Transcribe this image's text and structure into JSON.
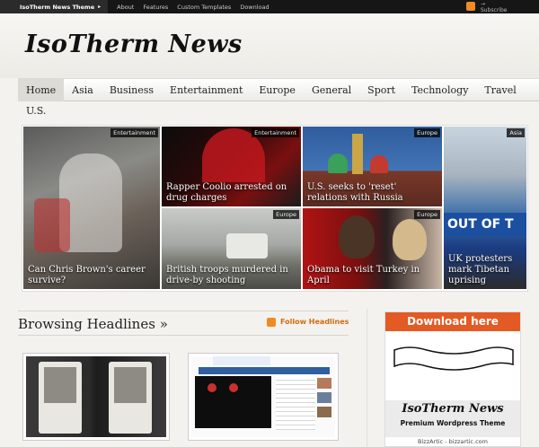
{
  "topbar": {
    "brand": "IsoTherm News Theme",
    "links": [
      "About",
      "Features",
      "Custom Templates",
      "Download"
    ],
    "subscribe": "Subscribe"
  },
  "header": {
    "logo": "IsoTherm News"
  },
  "nav": {
    "items": [
      "Home",
      "Asia",
      "Business",
      "Entertainment",
      "Europe",
      "General",
      "Sport",
      "Technology",
      "Travel"
    ],
    "second_row": "U.S.",
    "active": "Home"
  },
  "features": [
    {
      "tag": "Entertainment",
      "caption": "Can Chris Brown's career survive?"
    },
    {
      "tag": "Entertainment",
      "caption": "Rapper Coolio arrested on drug charges"
    },
    {
      "tag": "Europe",
      "caption": "U.S. seeks to 'reset' relations with Russia"
    },
    {
      "tag": "Asia",
      "caption": "UK protesters mark Tibetan uprising"
    },
    {
      "tag": "Europe",
      "caption": "British troops murdered in drive-by shooting"
    },
    {
      "tag": "Europe",
      "caption": "Obama to visit Turkey in April"
    }
  ],
  "browsing": {
    "title": "Browsing Headlines »",
    "follow": "Follow Headlines"
  },
  "ad": {
    "download": "Download here",
    "logo": "IsoTherm News",
    "subtitle": "Premium Wordpress Theme",
    "url": "BizzArtic - bizzartic.com"
  },
  "colors": {
    "accent": "#e35a24",
    "rss": "#f08a24",
    "topbar": "#161616"
  }
}
